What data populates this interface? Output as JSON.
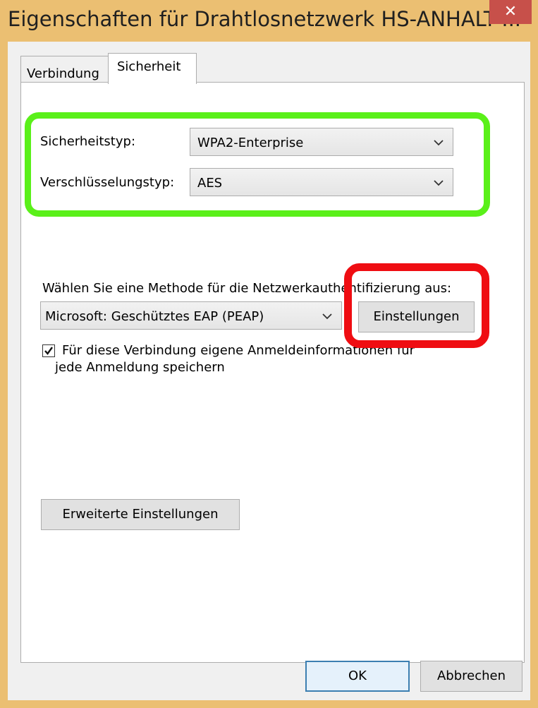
{
  "window": {
    "title": "Eigenschaften für Drahtlosnetzwerk HS-ANHALT-...",
    "close_label": "✕"
  },
  "tabs": [
    {
      "label": "Verbindung",
      "selected": false
    },
    {
      "label": "Sicherheit",
      "selected": true
    }
  ],
  "security": {
    "type_label": "Sicherheitstyp:",
    "type_value": "WPA2-Enterprise",
    "encryption_label": "Verschlüsselungstyp:",
    "encryption_value": "AES"
  },
  "auth": {
    "prompt_label": "Wählen Sie eine Methode für die Netzwerkauthentifizierung aus:",
    "method_value": "Microsoft: Geschütztes EAP (PEAP)",
    "settings_button": "Einstellungen",
    "remember_checked": true,
    "remember_line1": "Für diese Verbindung eigene Anmeldeinformationen für",
    "remember_line2": "jede Anmeldung speichern"
  },
  "advanced_button": "Erweiterte Einstellungen",
  "footer": {
    "ok_label": "OK",
    "cancel_label": "Abbrechen"
  },
  "highlight_colors": {
    "green": "#5af019",
    "red": "#ef0d12"
  }
}
